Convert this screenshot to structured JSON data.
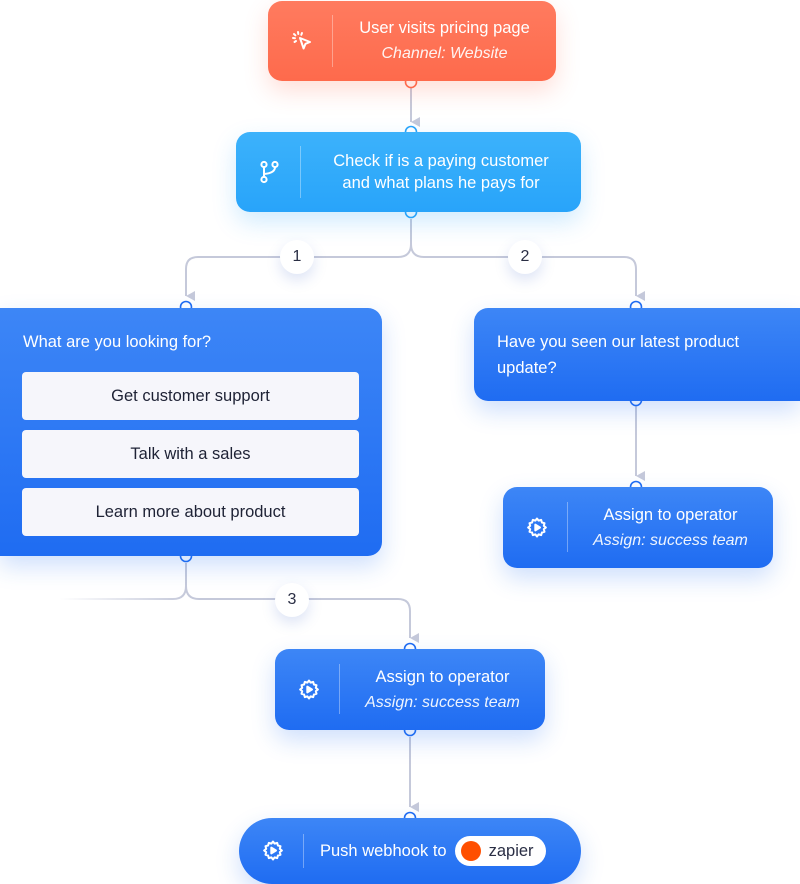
{
  "colors": {
    "trigger": "#fe6a4c",
    "condition": "#28a4fa",
    "action": "#1f6cf2",
    "edge": "#c5c9da",
    "option_bg": "#f6f6fb",
    "zapier": "#ff4f00"
  },
  "nodes": {
    "trigger": {
      "icon": "cursor-click-icon",
      "title": "User visits pricing page",
      "subtitle": "Channel: Website"
    },
    "condition": {
      "icon": "git-branch-icon",
      "line1": "Check if is a paying customer",
      "line2": "and what plans he pays for"
    },
    "question_left": {
      "title": "What are you looking for?",
      "options": [
        "Get customer support",
        "Talk with a sales",
        "Learn more about product"
      ]
    },
    "question_right": {
      "title": "Have you seen our latest product update?"
    },
    "assign_right": {
      "icon": "gear-play-icon",
      "title": "Assign to operator",
      "subtitle": "Assign: success team"
    },
    "assign_center": {
      "icon": "gear-play-icon",
      "title": "Assign to operator",
      "subtitle": "Assign: success team"
    },
    "webhook": {
      "icon": "gear-play-icon",
      "title": "Push webhook to",
      "integration": "zapier"
    }
  },
  "branches": {
    "b1": "1",
    "b2": "2",
    "b3": "3"
  }
}
